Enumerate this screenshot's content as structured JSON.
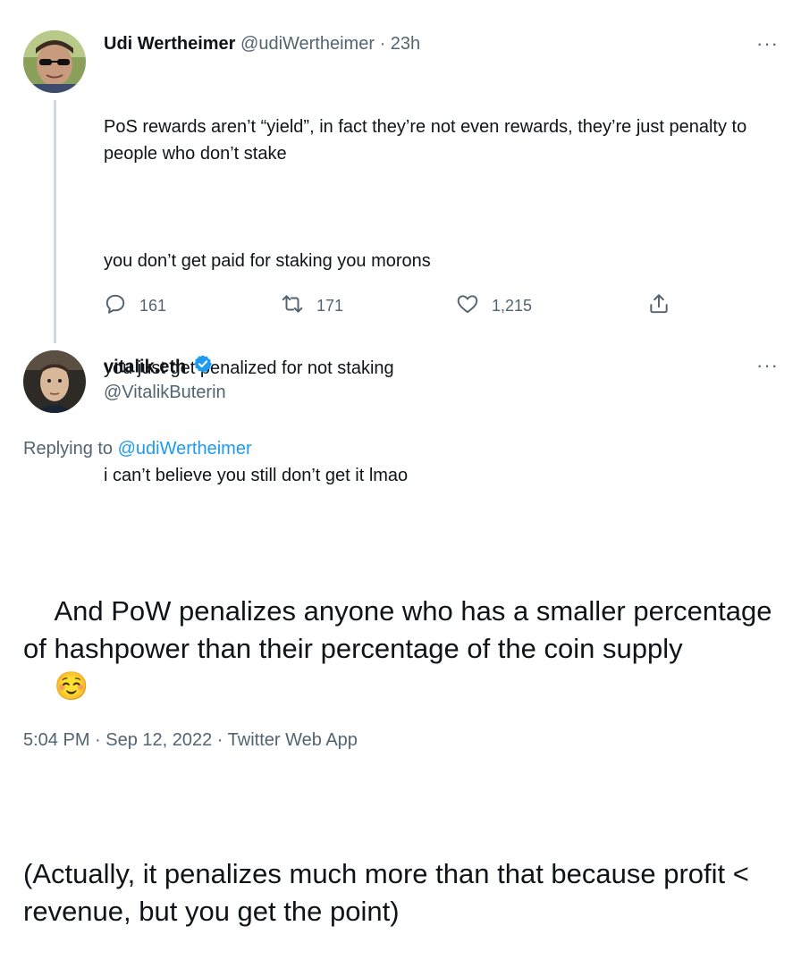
{
  "parent_tweet": {
    "display_name": "Udi Wertheimer",
    "handle": "@udiWertheimer",
    "separator": "·",
    "time_ago": "23h",
    "more_label": "···",
    "paragraphs": [
      "PoS rewards aren’t “yield”, in fact they’re not even rewards, they’re just penalty to people who don’t stake",
      "you don’t get paid for staking you morons",
      "you just get penalized for not staking",
      "i can’t believe you still don’t get it lmao"
    ],
    "actions": {
      "replies": "161",
      "retweets": "171",
      "likes": "1,215"
    }
  },
  "main_tweet": {
    "display_name": "vitalik.eth",
    "verified_icon": "verified-badge-icon",
    "handle": "@VitalikButerin",
    "more_label": "···",
    "replying_to_label": "Replying to",
    "replying_to_handle": "@udiWertheimer",
    "paragraph_1": "And PoW penalizes anyone who has a smaller percentage of hashpower than their percentage of the coin supply",
    "emoji": "☺️",
    "paragraph_2": "(Actually, it penalizes much more than that because profit < revenue, but you get the point)",
    "timestamp": "5:04 PM · Sep 12, 2022 · Twitter Web App"
  },
  "colors": {
    "accent": "#1d9bf0",
    "muted": "#536471",
    "thread_line": "#cfd9de"
  }
}
